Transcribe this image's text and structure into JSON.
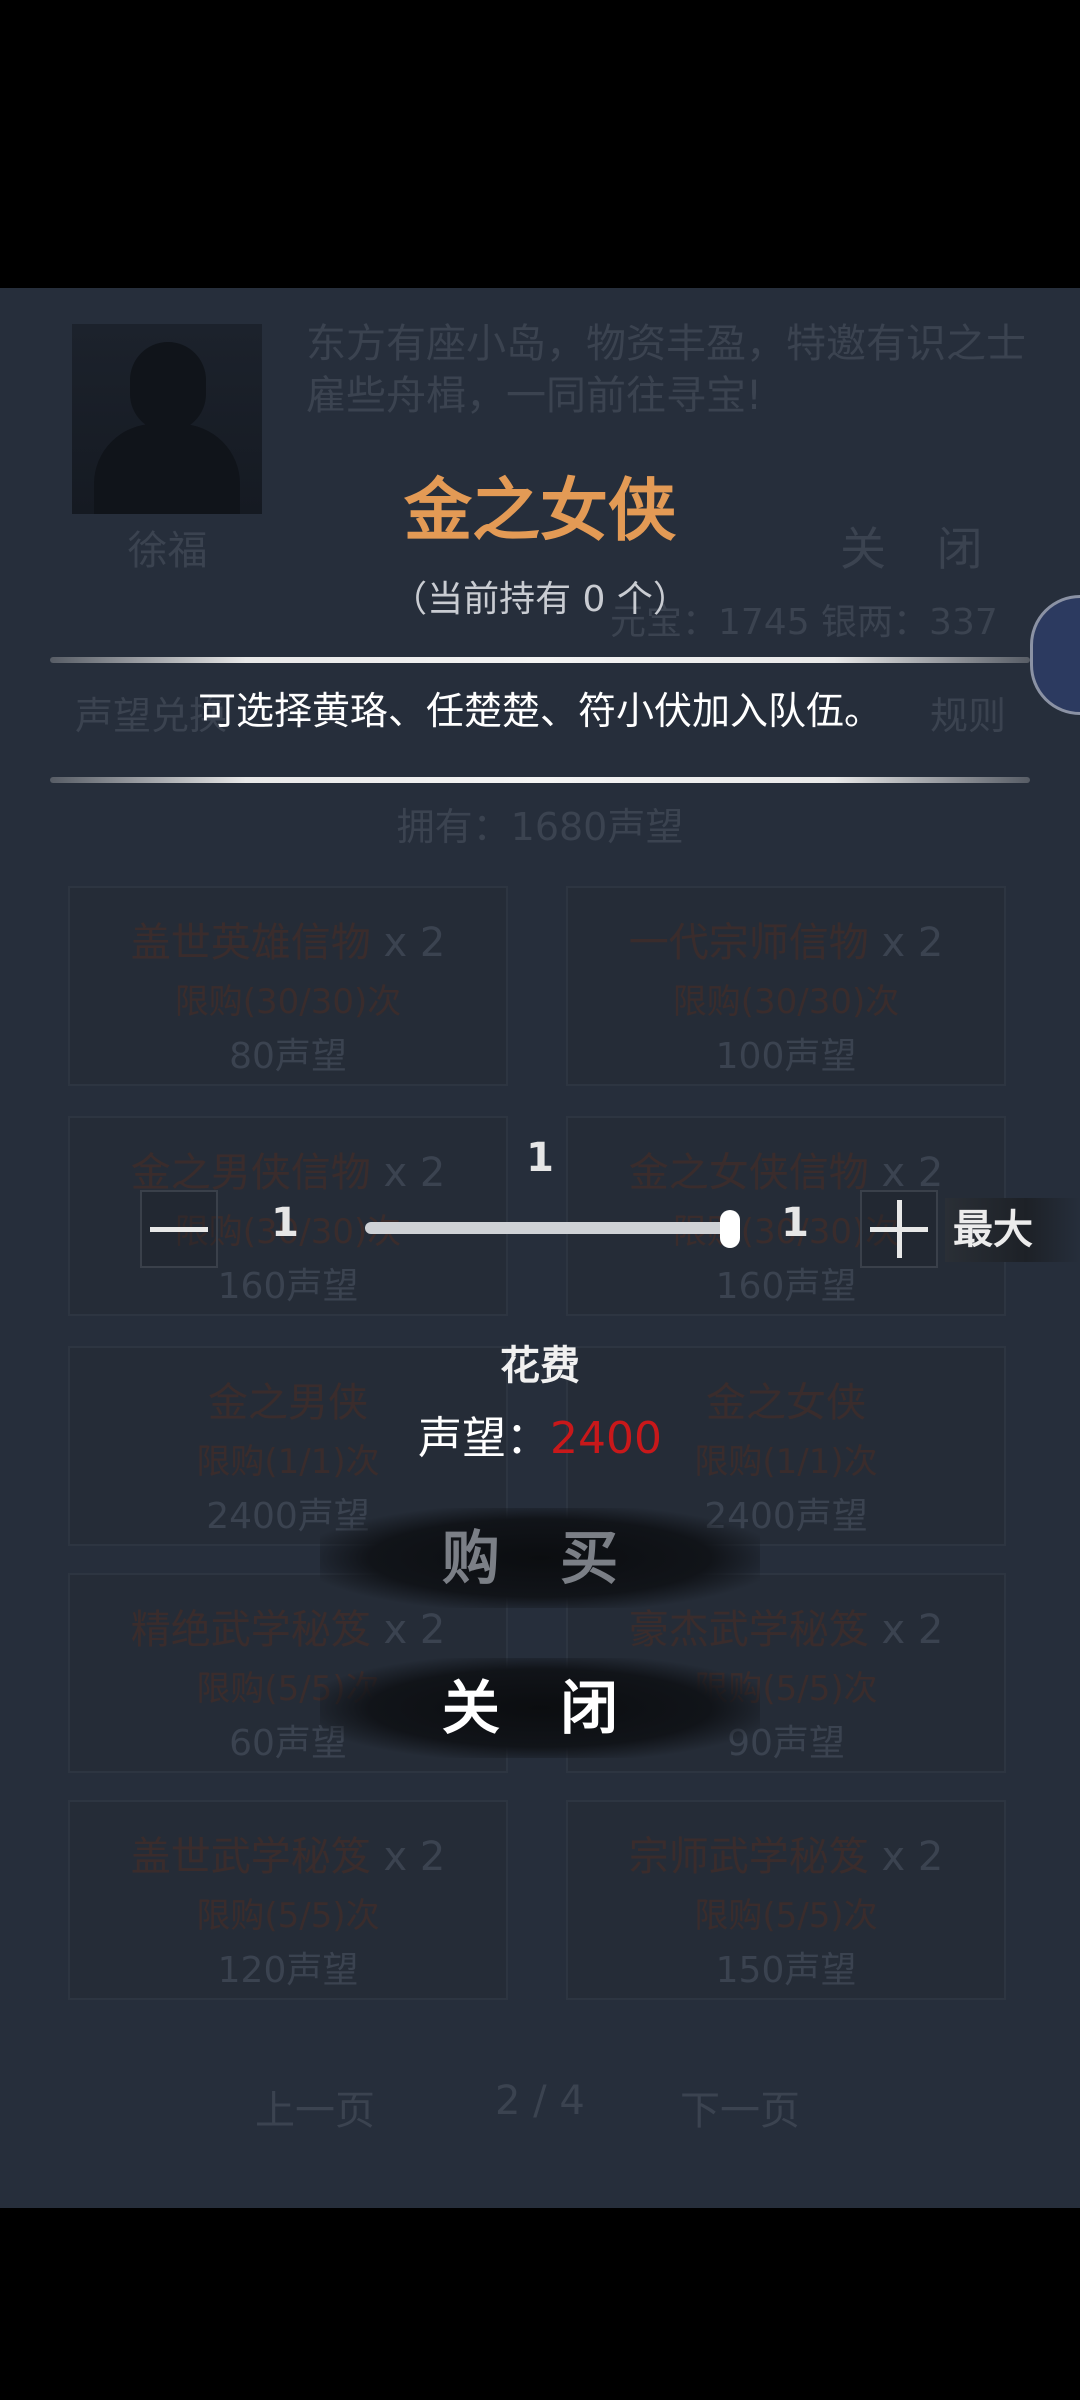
{
  "background": {
    "npc_name": "徐福",
    "npc_description": "东方有座小岛，物资丰盈，特邀有识之士雇些舟楫，一同前往寻宝!",
    "close_label": "关 闭",
    "currency": "元宝：1745  银两：337",
    "tabs": [
      "声望兑换",
      "规则"
    ],
    "owned_text": "拥有：1680声望",
    "cards": [
      {
        "name": "盖世英雄信物",
        "count": "x 2",
        "limit": "限购(30/30)次",
        "price": "80声望"
      },
      {
        "name": "一代宗师信物",
        "count": "x 2",
        "limit": "限购(30/30)次",
        "price": "100声望"
      },
      {
        "name": "金之男侠信物",
        "count": "x 2",
        "limit": "限购(30/30)次",
        "price": "160声望"
      },
      {
        "name": "金之女侠信物",
        "count": "x 2",
        "limit": "限购(30/30)次",
        "price": "160声望"
      },
      {
        "name": "金之男侠",
        "count": "",
        "limit": "限购(1/1)次",
        "price": "2400声望"
      },
      {
        "name": "金之女侠",
        "count": "",
        "limit": "限购(1/1)次",
        "price": "2400声望"
      },
      {
        "name": "精绝武学秘笈",
        "count": "x 2",
        "limit": "限购(5/5)次",
        "price": "60声望"
      },
      {
        "name": "豪杰武学秘笈",
        "count": "x 2",
        "limit": "限购(5/5)次",
        "price": "90声望"
      },
      {
        "name": "盖世武学秘笈",
        "count": "x 2",
        "limit": "限购(5/5)次",
        "price": "120声望"
      },
      {
        "name": "宗师武学秘笈",
        "count": "x 2",
        "limit": "限购(5/5)次",
        "price": "150声望"
      }
    ],
    "pager": {
      "prev": "上一页",
      "page": "2 / 4",
      "next": "下一页"
    }
  },
  "dialog": {
    "title": "金之女侠",
    "holding": "（当前持有 0 个）",
    "description": "可选择黄珞、任楚楚、符小伏加入队伍。",
    "quantity": "1",
    "min_value": "1",
    "max_value": "1",
    "max_button": "最大",
    "cost_label": "花费",
    "cost_key": "声望：",
    "cost_value": "2400",
    "buy_button": "购 买",
    "close_button": "关 闭"
  },
  "colors": {
    "title": "#e39a55",
    "cost_value": "#c8181a",
    "panel": "#262e3b"
  }
}
